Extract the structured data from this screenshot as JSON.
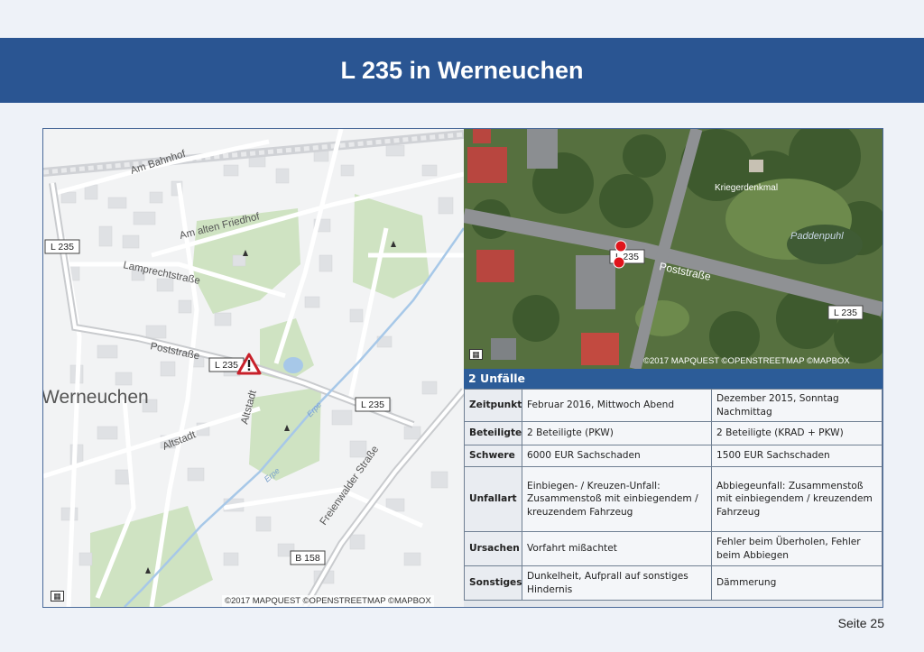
{
  "slide": {
    "title": "L 235 in Werneuchen",
    "page_label": "Seite 25",
    "colors": {
      "title_bar": "#2a5592",
      "panel_header": "#2c5c98",
      "background": "#eef2f8"
    }
  },
  "street_map": {
    "labels": {
      "am_bahnhof": "Am Bahnhof",
      "am_alten_friedhof": "Am alten Friedhof",
      "lamprechtstrasse": "Lamprechtstraße",
      "poststrasse": "Poststraße",
      "altstadt_vertical": "Altstadt",
      "altstadt": "Altstadt",
      "town": "Werneuchen",
      "erpe_1": "Erpe",
      "erpe_2": "Erpe",
      "freienwalder_strasse": "Freienwalder Straße"
    },
    "road_shields": {
      "l235_top": "L 235",
      "l235_center": "L 235",
      "l235_east": "L 235",
      "b158": "B 158"
    },
    "attribution": "©2017 MAPQUEST ©OPENSTREETMAP ©MAPBOX",
    "icons": {
      "warning": "warning-triangle-icon",
      "tree": "tree-icon",
      "book": "book-icon"
    }
  },
  "aerial_map": {
    "labels": {
      "kriegerdenkmal": "Kriegerdenkmal",
      "paddenpuhl": "Paddenpuhl",
      "poststrasse": "Poststraße"
    },
    "road_shields": {
      "l235_center": "L 235",
      "l235_east": "L 235"
    },
    "attribution": "©2017 MAPQUEST ©OPENSTREETMAP ©MAPBOX",
    "markers": [
      {
        "name": "accident-marker-1"
      },
      {
        "name": "accident-marker-2"
      }
    ]
  },
  "accidents": {
    "header": "2 Unfälle",
    "rows": [
      {
        "label": "Zeitpunkt",
        "a": "Februar 2016, Mittwoch Abend",
        "b": "Dezember 2015, Sonntag Nachmittag"
      },
      {
        "label": "Beteiligte",
        "a": "2 Beteiligte (PKW)",
        "b": "2 Beteiligte (KRAD + PKW)"
      },
      {
        "label": "Schwere",
        "a": "6000 EUR Sachschaden",
        "b": "1500 EUR Sachschaden"
      },
      {
        "label": "Unfallart",
        "a": "Einbiegen- / Kreuzen-Unfall: Zusammenstoß mit einbiegendem / kreuzendem Fahrzeug",
        "b": "Abbiegeunfall: Zusammenstoß mit einbiegendem / kreuzendem Fahrzeug"
      },
      {
        "label": "Ursachen",
        "a": "Vorfahrt mißachtet",
        "b": "Fehler beim Überholen, Fehler beim Abbiegen"
      },
      {
        "label": "Sonstiges",
        "a": "Dunkelheit, Aufprall auf sonstiges Hindernis",
        "b": "Dämmerung"
      }
    ]
  }
}
